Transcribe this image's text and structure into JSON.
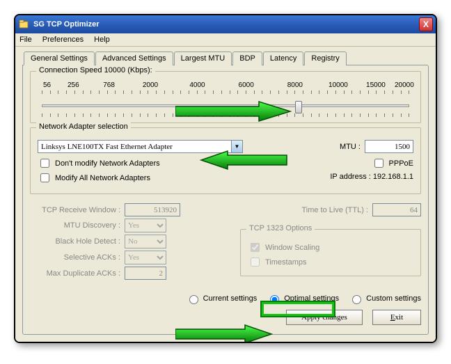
{
  "window": {
    "title": "SG TCP Optimizer",
    "close_label": "X"
  },
  "menu": {
    "file": "File",
    "prefs": "Preferences",
    "help": "Help"
  },
  "tabs": {
    "general": "General Settings",
    "advanced": "Advanced Settings",
    "mtu": "Largest MTU",
    "bdp": "BDP",
    "latency": "Latency",
    "registry": "Registry"
  },
  "conn": {
    "title": "Connection Speed  10000 (Kbps):",
    "ticks": [
      "56",
      "256",
      "768",
      "2000",
      "4000",
      "6000",
      "8000",
      "10000",
      "15000",
      "20000"
    ]
  },
  "adapter": {
    "title": "Network Adapter selection",
    "selected": "Linksys LNE100TX Fast Ethernet Adapter",
    "dont_modify": "Don't modify Network Adapters",
    "modify_all": "Modify All Network Adapters",
    "mtu_label": "MTU :",
    "mtu_value": "1500",
    "pppoe": "PPPoE",
    "ip_label": "IP address : 192.168.1.1"
  },
  "left": {
    "tcp_rwin_label": "TCP Receive Window :",
    "tcp_rwin_value": "513920",
    "mtu_disc_label": "MTU Discovery :",
    "mtu_disc_value": "Yes",
    "bhd_label": "Black Hole Detect :",
    "bhd_value": "No",
    "sacks_label": "Selective ACKs :",
    "sacks_value": "Yes",
    "maxdup_label": "Max Duplicate ACKs :",
    "maxdup_value": "2"
  },
  "right": {
    "ttl_label": "Time to Live (TTL) :",
    "ttl_value": "64",
    "tcp1323_title": "TCP 1323 Options",
    "winscale": "Window Scaling",
    "timestamps": "Timestamps"
  },
  "bottom": {
    "current": "Current settings",
    "optimal": "Optimal settings",
    "custom": "Custom settings",
    "apply": "Apply changes",
    "exit": "Exit"
  }
}
